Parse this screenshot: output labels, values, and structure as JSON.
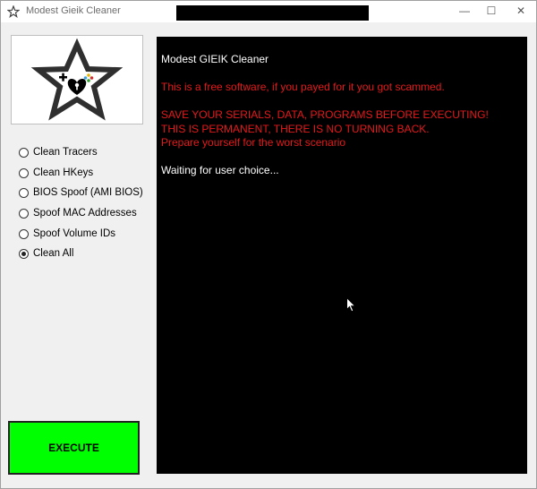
{
  "window": {
    "title": "Modest Gieik Cleaner",
    "title_icon": "star-icon",
    "controls": {
      "minimize": "—",
      "maximize": "☐",
      "close": "✕"
    }
  },
  "logo": {
    "icon": "star-logo-icon",
    "colors": {
      "outline": "#333333",
      "lock": "#000000"
    }
  },
  "options": [
    {
      "label": "Clean Tracers",
      "checked": false
    },
    {
      "label": "Clean HKeys",
      "checked": false
    },
    {
      "label": "BIOS Spoof (AMI BIOS)",
      "checked": false
    },
    {
      "label": "Spoof MAC Addresses",
      "checked": false
    },
    {
      "label": "Spoof Volume IDs",
      "checked": false
    },
    {
      "label": "Clean All",
      "checked": true
    }
  ],
  "execute": {
    "label": "EXECUTE",
    "color": "#00ff00"
  },
  "console": {
    "lines": [
      {
        "text": "Modest GIEIK Cleaner",
        "color": "white"
      },
      {
        "text": "",
        "color": "white"
      },
      {
        "text": "This is a free software, if you payed for it you got scammed.",
        "color": "red"
      },
      {
        "text": "",
        "color": "white"
      },
      {
        "text": "SAVE YOUR SERIALS, DATA, PROGRAMS BEFORE EXECUTING!",
        "color": "red"
      },
      {
        "text": "THIS IS PERMANENT, THERE IS NO TURNING BACK.",
        "color": "red"
      },
      {
        "text": "Prepare yourself for the worst scenario",
        "color": "red"
      },
      {
        "text": "",
        "color": "white"
      },
      {
        "text": "Waiting for user choice...",
        "color": "white"
      }
    ]
  }
}
